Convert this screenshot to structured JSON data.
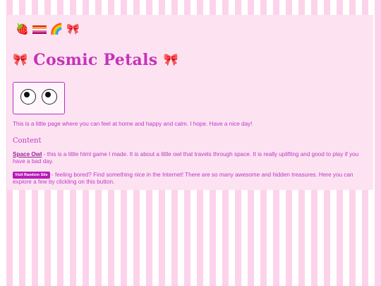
{
  "badges": [
    {
      "name": "strawberry-icon",
      "glyph": "🍓"
    },
    {
      "name": "lesbian-flag-icon",
      "colors": [
        "#d62900",
        "#ff9b55",
        "#ffffff",
        "#d462a6",
        "#a50062"
      ]
    },
    {
      "name": "rainbow-icon",
      "glyph": "🌈"
    },
    {
      "name": "bow-icon",
      "glyph": "🎀"
    }
  ],
  "header": {
    "title": "Cosmic Petals",
    "bow_glyph": "🎀"
  },
  "intro": "This is a little page where you can feel at home and happy and calm. I hope. Have a nice day!",
  "content": {
    "heading": "Content",
    "game_link": "Space Owl",
    "game_desc": " - this is a little html game I made. It is about a little owl that travels through space. It is really uplifitng and good to play if you have a bad day.",
    "random_button": "Visit Random Site",
    "random_desc": " - feeling bored? Find something nice in the Internet! There are so many awesome and hidden treasures. Here you can explore a few by clickling on this button."
  },
  "colors": {
    "accent": "#c633b8",
    "text": "#bb37c4",
    "panel": "#fde3f2",
    "stripe": "#fcd3ea"
  }
}
